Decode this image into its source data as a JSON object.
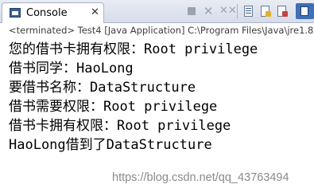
{
  "tab": {
    "label": "Console",
    "close": "✕"
  },
  "toolbar": {
    "terminate_icon": "terminate-icon",
    "remove_icon": "remove-launch-icon",
    "remove_all_icon": "remove-all-terminated-icon",
    "scroll_lock_icon": "scroll-lock-icon",
    "show_stdout_icon": "show-console-on-stdout-icon",
    "show_stderr_icon": "show-console-on-stderr-icon",
    "pin_icon": "pin-console-icon"
  },
  "info_bar": {
    "text": "<terminated> Test4 [Java Application] C:\\Program Files\\Java\\jre1.8"
  },
  "console_output": [
    "您的借书卡拥有权限：Root privilege",
    "借书同学：HaoLong",
    "要借书名称：DataStructure",
    "借书需要权限：Root privilege",
    "借书卡拥有权限：Root privilege",
    "HaoLong借到了DataStructure"
  ],
  "watermark": "https://blog.csdn.net/qq_43763494",
  "colors": {
    "tab_bar_bg": "#dde2ec",
    "text": "#000000",
    "info_text": "#3c3c3c",
    "watermark": "#8a8a8a"
  }
}
